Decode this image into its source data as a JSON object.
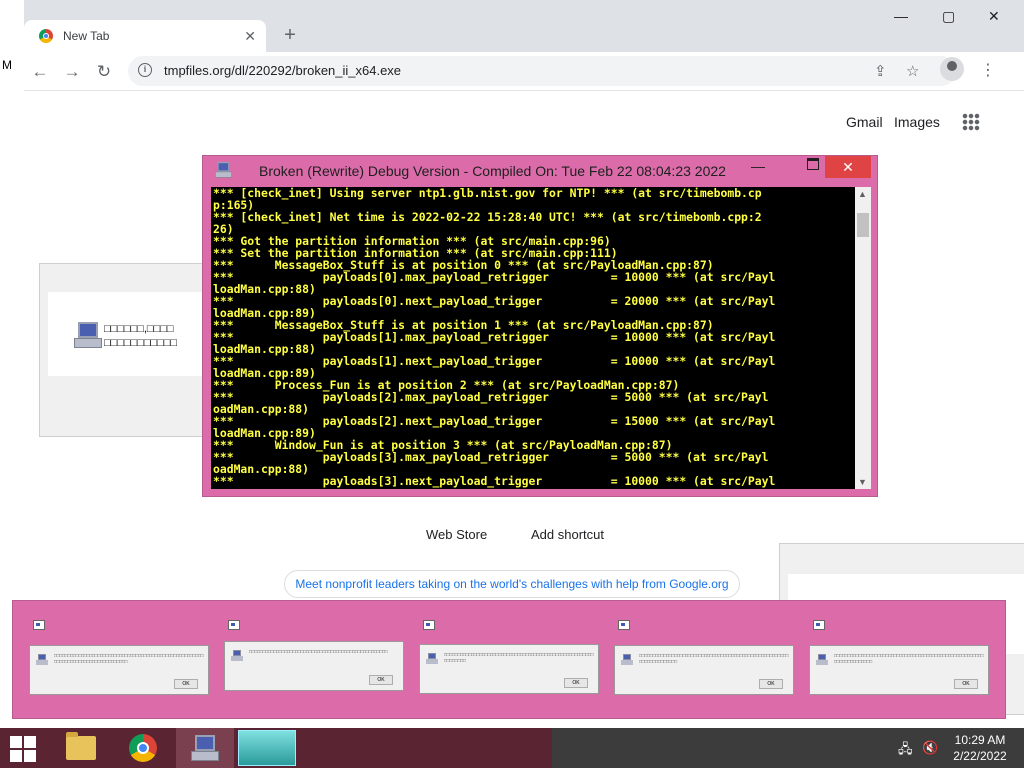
{
  "browser": {
    "tab_title": "New Tab",
    "url": "tmpfiles.org/dl/220292/broken_ii_x64.exe",
    "new_tab_symbol": "+",
    "tab_close_symbol": "✕",
    "window_minimize": "—",
    "window_maximize": "▢",
    "window_close": "✕",
    "nav": {
      "back": "←",
      "forward": "→",
      "reload": "↻"
    },
    "omnibox_icons": {
      "share": "⇪",
      "bookmark": "☆"
    },
    "menu": "⋮"
  },
  "stray_text": "M",
  "new_tab_page": {
    "links": {
      "gmail": "Gmail",
      "images": "Images"
    },
    "shortcuts": {
      "web_store": "Web Store",
      "add_shortcut": "Add shortcut"
    },
    "promo_text": "Meet nonprofit leaders taking on the world's challenges with help from Google.org"
  },
  "bg_message": {
    "line1": "□□□□□□,□□□□",
    "line2": "□□□□□□□□□□□"
  },
  "console": {
    "title": "Broken (Rewrite) Debug Version - Compiled On: Tue Feb 22 08:04:23 2022",
    "minimize": "—",
    "close": "✕",
    "lines": [
      "*** [check_inet] Using server ntp1.glb.nist.gov for NTP! *** (at src/timebomb.cp",
      "p:165)",
      "*** [check_inet] Net time is 2022-02-22 15:28:40 UTC! *** (at src/timebomb.cpp:2",
      "26)",
      "*** Got the partition information *** (at src/main.cpp:96)",
      "*** Set the partition information *** (at src/main.cpp:111)",
      "***      MessageBox_Stuff is at position 0 *** (at src/PayloadMan.cpp:87)",
      "***             payloads[0].max_payload_retrigger         = 10000 *** (at src/Payl",
      "loadMan.cpp:88)",
      "***             payloads[0].next_payload_trigger          = 20000 *** (at src/Payl",
      "loadMan.cpp:89)",
      "***      MessageBox_Stuff is at position 1 *** (at src/PayloadMan.cpp:87)",
      "***             payloads[1].max_payload_retrigger         = 10000 *** (at src/Payl",
      "loadMan.cpp:88)",
      "***             payloads[1].next_payload_trigger          = 10000 *** (at src/Payl",
      "loadMan.cpp:89)",
      "***      Process_Fun is at position 2 *** (at src/PayloadMan.cpp:87)",
      "***             payloads[2].max_payload_retrigger         = 5000 *** (at src/Payl",
      "oadMan.cpp:88)",
      "***             payloads[2].next_payload_trigger          = 15000 *** (at src/Payl",
      "loadMan.cpp:89)",
      "***      Window_Fun is at position 3 *** (at src/PayloadMan.cpp:87)",
      "***             payloads[3].max_payload_retrigger         = 5000 *** (at src/Payl",
      "oadMan.cpp:88)",
      "***             payloads[3].next_payload_trigger          = 10000 *** (at src/Payl"
    ]
  },
  "message_boxes": [
    {
      "text": "□□□□□□□□□□□□□□□□□□□□□□□□□□□□□□□□□□□□□□□□□□□□□□□□□□□□□□□□□□□□□□□□□□□□□□□□□□□□□□□□□□",
      "ok": "OK"
    },
    {
      "text": "□□□□□□□□□□□□□□□□□□□□□□□□□□□□□□□□□□□□□□□□□□□□□□□□□□□",
      "ok": "OK"
    },
    {
      "text": "□□□□□□□□□□□□□□□□□□□□□□□□□□□□□□□□□□□□□□□□□□□□□□□□□□□□□□□□□□□□□□□",
      "ok": "OK"
    },
    {
      "text": "□□□□□□□□□□□□□□□□□□□□□□□□□□□□□□□□□□□□□□□□□□□□□□□□□□□□□□□□□□□□□□□□□□□□□",
      "ok": "OK"
    },
    {
      "text": "□□□□□□□□□□□□□□□□□□□□□□□□□□□□□□□□□□□□□□□□□□□□□□□□□□□□□□□□□□□□□□□□□□□□□",
      "ok": "OK"
    }
  ],
  "taskbar": {
    "time": "10:29 AM",
    "date": "2/22/2022",
    "tray": {
      "network": "🖧",
      "volume": "🔇"
    }
  }
}
